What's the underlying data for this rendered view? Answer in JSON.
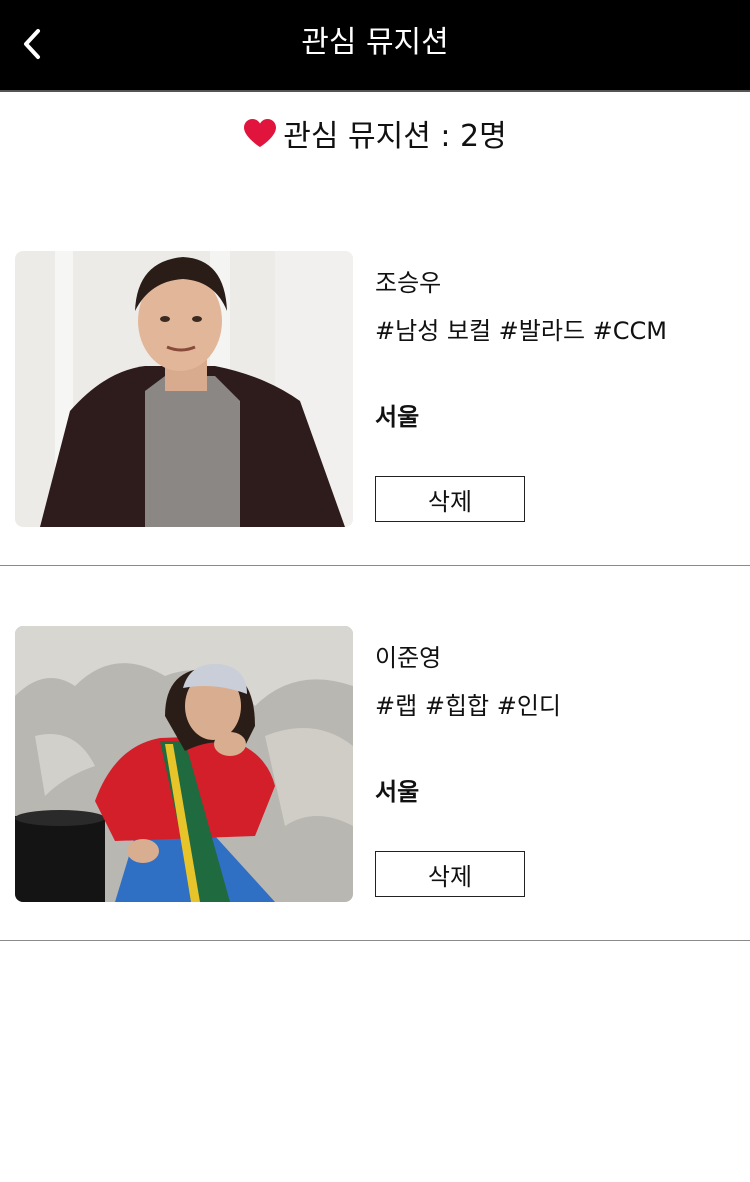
{
  "header": {
    "title": "관심 뮤지션",
    "back_icon": "chevron-left-icon"
  },
  "summary": {
    "heart_icon": "heart-icon",
    "heart_color": "#e0143c",
    "label": "관심 뮤지션 : 2명"
  },
  "musicians": [
    {
      "name": "조승우",
      "tags": "#남성 보컬 #발라드 #CCM",
      "region": "서울",
      "delete_label": "삭제"
    },
    {
      "name": "이준영",
      "tags": "#랩 #힙합 #인디",
      "region": "서울",
      "delete_label": "삭제"
    }
  ]
}
